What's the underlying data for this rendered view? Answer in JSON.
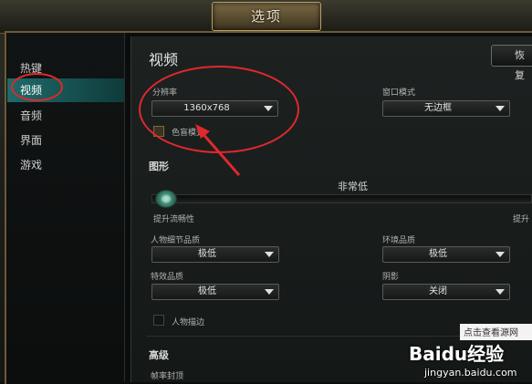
{
  "window": {
    "title": "选项"
  },
  "sidebar": {
    "items": [
      {
        "label": "热键",
        "active": false
      },
      {
        "label": "视频",
        "active": true
      },
      {
        "label": "音频",
        "active": false
      },
      {
        "label": "界面",
        "active": false
      },
      {
        "label": "游戏",
        "active": false
      }
    ]
  },
  "panel": {
    "title": "视频",
    "reset_label": "恢复",
    "resolution": {
      "label": "分辨率",
      "value": "1360x768"
    },
    "window_mode": {
      "label": "窗口模式",
      "value": "无边框"
    },
    "colorblind": {
      "label": "色盲模式",
      "checked": true
    },
    "graphics": {
      "title": "图形",
      "preset_value": "非常低",
      "slider_left_label": "提升流畅性",
      "slider_right_label": "提升",
      "slider_level": 0.0
    },
    "character_quality": {
      "label": "人物细节品质",
      "value": "极低"
    },
    "environment_quality": {
      "label": "环境品质",
      "value": "极低"
    },
    "effects_quality": {
      "label": "特效品质",
      "value": "极低"
    },
    "shadows": {
      "label": "阴影",
      "value": "关闭"
    },
    "character_outline": {
      "label": "人物描边",
      "checked": false
    },
    "advanced": {
      "title": "高级",
      "frame_cap_label": "帧率封顶"
    }
  },
  "watermark": {
    "source_link": "点击查看源网",
    "brand": "Baidu经验",
    "url": "jingyan.baidu.com"
  },
  "colors": {
    "accent": "#1f6b6a",
    "annotation": "#e0282d",
    "gold": "#6d5b33"
  }
}
